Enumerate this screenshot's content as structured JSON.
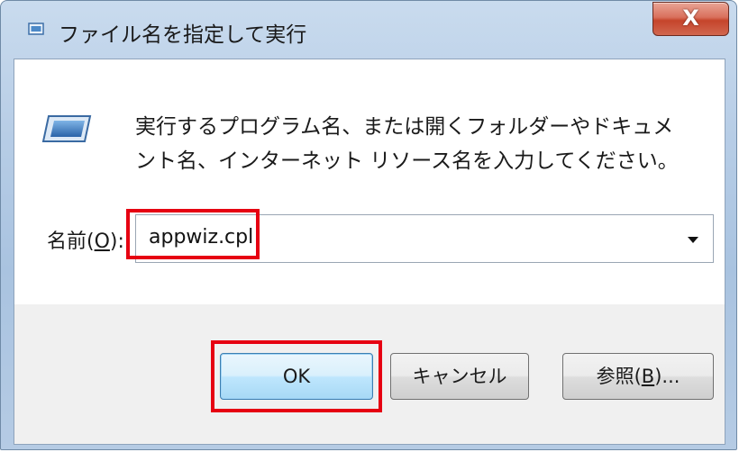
{
  "window": {
    "title": "ファイル名を指定して実行",
    "title_icon": "run-icon",
    "close_label": "X"
  },
  "description": {
    "line1": "実行するプログラム名、または開くフォルダーやドキュメ",
    "line2": "ント名、インターネット リソース名を入力してください。"
  },
  "name_field": {
    "label_prefix": "名前(",
    "label_accel": "O",
    "label_suffix": "):",
    "value": "appwiz.cpl"
  },
  "buttons": {
    "ok": "OK",
    "cancel": "キャンセル",
    "browse_prefix": "参照(",
    "browse_accel": "B",
    "browse_suffix": ")..."
  },
  "annotations": {
    "highlight_color": "#e60012"
  }
}
